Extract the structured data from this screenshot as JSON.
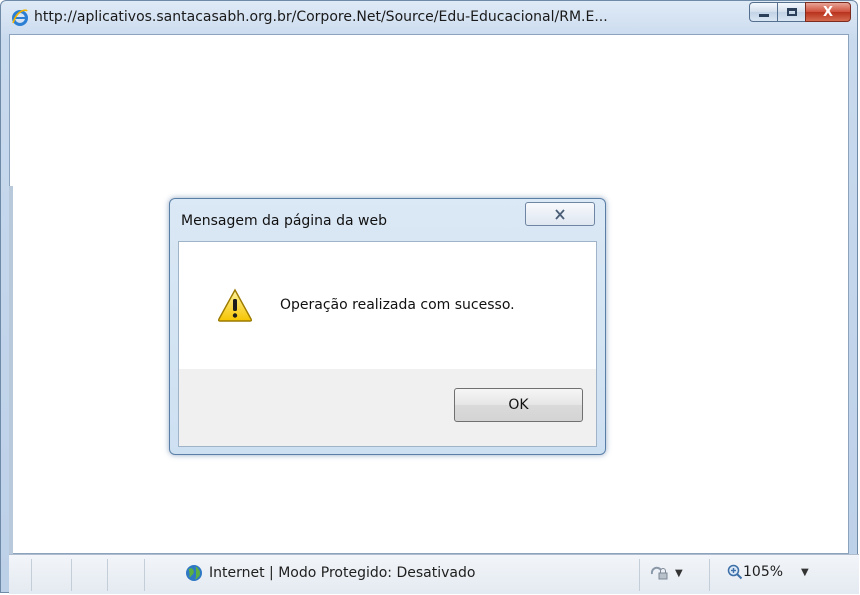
{
  "window": {
    "title": "http://aplicativos.santacasabh.org.br/Corpore.Net/Source/Edu-Educacional/RM.E...",
    "icon": "ie-icon",
    "caption_buttons": [
      "minimize",
      "maximize",
      "close"
    ]
  },
  "dialog": {
    "title": "Mensagem da página da web",
    "message": "Operação realizada com sucesso.",
    "icon": "warning-icon",
    "ok_label": "OK"
  },
  "statusbar": {
    "zone_text": "Internet | Modo Protegido: Desativado",
    "zoom": "105%"
  },
  "colors": {
    "frame": "#bcd0e8",
    "close_button": "#cf4f3a",
    "warning_yellow": "#f5c400"
  }
}
